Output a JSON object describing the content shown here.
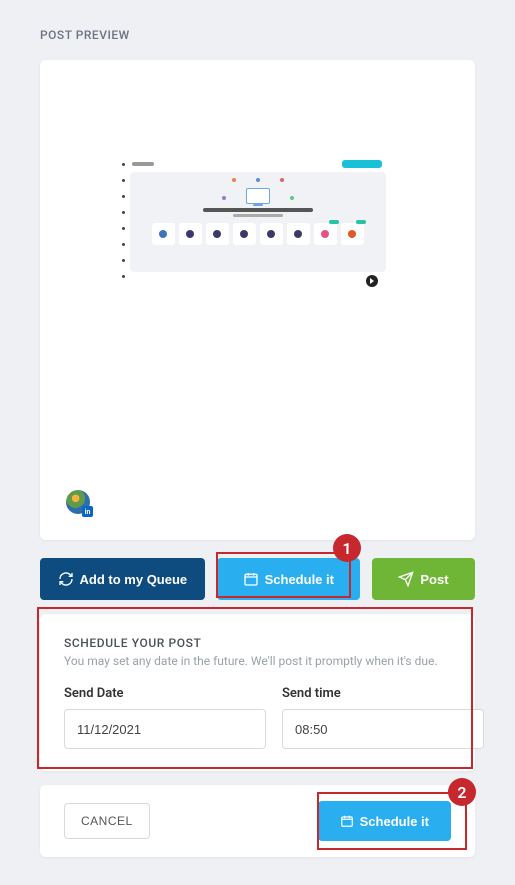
{
  "sectionTitle": "POST PREVIEW",
  "buttons": {
    "addQueue": "Add to my Queue",
    "scheduleIt": "Schedule it",
    "post": "Post"
  },
  "schedulePanel": {
    "title": "SCHEDULE YOUR POST",
    "subtitle": "You may set any date in the future. We'll post it promptly when it's due.",
    "dateLabel": "Send Date",
    "timeLabel": "Send time",
    "dateValue": "11/12/2021",
    "timeValue": "08:50"
  },
  "footer": {
    "cancel": "CANCEL",
    "scheduleIt": "Schedule it"
  },
  "annotations": {
    "one": "1",
    "two": "2"
  }
}
